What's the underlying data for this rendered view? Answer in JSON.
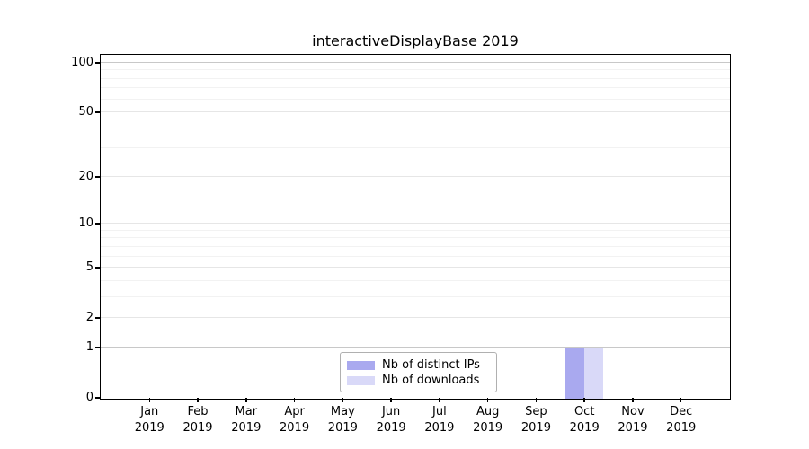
{
  "chart_data": {
    "type": "bar",
    "title": "interactiveDisplayBase 2019",
    "categories": [
      "Jan",
      "Feb",
      "Mar",
      "Apr",
      "May",
      "Jun",
      "Jul",
      "Aug",
      "Sep",
      "Oct",
      "Nov",
      "Dec"
    ],
    "category_year": "2019",
    "series": [
      {
        "name": "Nb of distinct IPs",
        "color": "#a9a9ef",
        "values": [
          0,
          0,
          0,
          0,
          0,
          0,
          0,
          0,
          0,
          1,
          0,
          0
        ]
      },
      {
        "name": "Nb of downloads",
        "color": "#d9d9f8",
        "values": [
          0,
          0,
          0,
          0,
          0,
          0,
          0,
          0,
          0,
          1,
          0,
          0
        ]
      }
    ],
    "y_axis": {
      "scale": "log1p",
      "ticks": [
        0,
        1,
        2,
        5,
        10,
        20,
        50,
        100
      ],
      "minor_ticks": [
        3,
        4,
        6,
        7,
        8,
        9,
        30,
        40,
        60,
        70,
        80,
        90
      ],
      "ylim": [
        0,
        112
      ]
    },
    "x_axis": {
      "tick_lines": 2
    },
    "legend": {
      "position": "inside-bottom-center",
      "border_color": "#b0b0b0"
    },
    "grid": "horizontal",
    "colors": {
      "grid_minor": "#f2f2f2",
      "grid_major": "#e6e6e6",
      "grid_strong": "#c8c8c8",
      "axis": "#000000"
    }
  }
}
